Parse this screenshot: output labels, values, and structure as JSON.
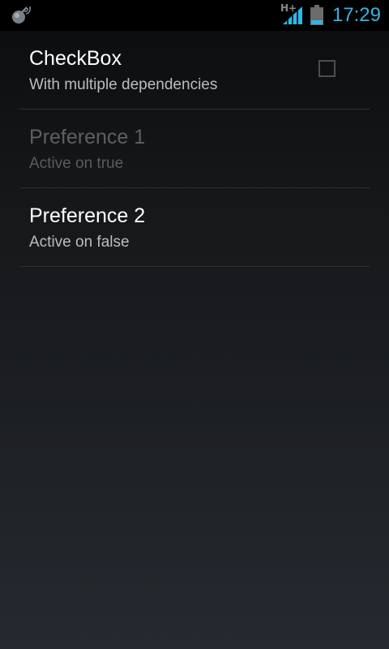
{
  "status_bar": {
    "network_type": "H+",
    "time": "17:29",
    "icons": [
      "app-notification-icon",
      "signal-icon",
      "battery-icon"
    ]
  },
  "preferences": [
    {
      "title": "CheckBox",
      "summary": "With multiple dependencies",
      "checked": false,
      "enabled": true
    },
    {
      "title": "Preference 1",
      "summary": "Active on true",
      "enabled": false
    },
    {
      "title": "Preference 2",
      "summary": "Active on false",
      "enabled": true
    }
  ],
  "colors": {
    "clock": "#33b5e5",
    "title_enabled": "#ffffff",
    "summary_enabled": "#bdbdbd",
    "title_disabled": "#5d5f61",
    "divider": "#2d3034"
  }
}
